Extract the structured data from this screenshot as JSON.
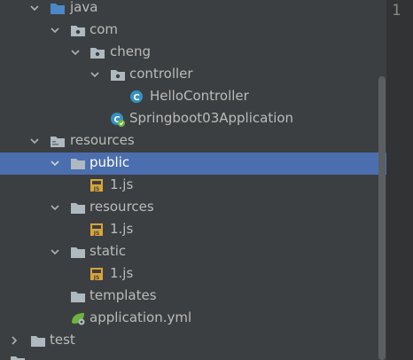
{
  "project_tree": {
    "items": [
      {
        "label": "java",
        "arrow": "expanded",
        "icon": "source-folder-icon"
      },
      {
        "label": "com",
        "arrow": "expanded",
        "icon": "package-icon"
      },
      {
        "label": "cheng",
        "arrow": "expanded",
        "icon": "package-icon"
      },
      {
        "label": "controller",
        "arrow": "expanded",
        "icon": "package-icon"
      },
      {
        "label": "HelloController",
        "arrow": "none",
        "icon": "java-class-icon"
      },
      {
        "label": "Springboot03Application",
        "arrow": "none",
        "icon": "spring-boot-class-icon"
      },
      {
        "label": "resources",
        "arrow": "expanded",
        "icon": "resources-folder-icon"
      },
      {
        "label": "public",
        "arrow": "expanded",
        "icon": "folder-icon",
        "selected": true
      },
      {
        "label": "1.js",
        "arrow": "none",
        "icon": "js-file-icon"
      },
      {
        "label": "resources",
        "arrow": "expanded",
        "icon": "folder-icon"
      },
      {
        "label": "1.js",
        "arrow": "none",
        "icon": "js-file-icon"
      },
      {
        "label": "static",
        "arrow": "expanded",
        "icon": "folder-icon"
      },
      {
        "label": "1.js",
        "arrow": "none",
        "icon": "js-file-icon"
      },
      {
        "label": "templates",
        "arrow": "none",
        "icon": "folder-icon"
      },
      {
        "label": "application.yml",
        "arrow": "none",
        "icon": "spring-config-icon"
      },
      {
        "label": "test",
        "arrow": "collapsed",
        "icon": "folder-icon"
      }
    ]
  },
  "editor": {
    "line_number": "1"
  },
  "colors": {
    "panel_bg": "#3c3f41",
    "selection": "#4b6eaf",
    "text": "#bbbbbb",
    "source_folder": "#4a88c7",
    "package_folder": "#aeb9c0",
    "js_icon": "#d8a53a",
    "class_icon": "#3592c4",
    "spring_green": "#6db33f"
  }
}
